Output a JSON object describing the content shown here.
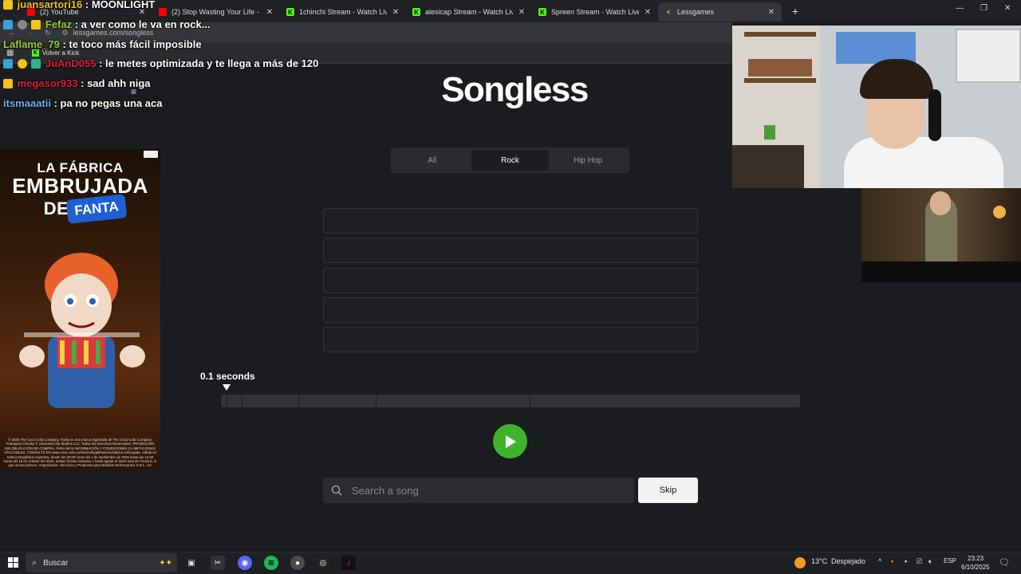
{
  "browser": {
    "tabs": [
      {
        "title": "(2) YouTube",
        "favicon": "youtube-icon",
        "color": "#ff0000"
      },
      {
        "title": "(2) Stop Wasting Your Life - You",
        "favicon": "youtube-icon",
        "color": "#ff0000"
      },
      {
        "title": "1chinchi Stream - Watch Live o",
        "favicon": "kick-icon",
        "color": "#53fc18"
      },
      {
        "title": "alesicap Stream - Watch Live o",
        "favicon": "kick-icon",
        "color": "#53fc18"
      },
      {
        "title": "Spreen Stream - Watch Live on",
        "favicon": "kick-icon",
        "color": "#53fc18"
      },
      {
        "title": "Lessgames",
        "favicon": "lessgames-icon",
        "color": "#e6d25a",
        "active": true
      }
    ],
    "url": "lessgames.com/songless",
    "bookmark": "Volver a Kick"
  },
  "chat": [
    {
      "user": "juansartori16",
      "msg": "MOONLIGHT",
      "color": "#f0c419"
    },
    {
      "user": "Fefaz",
      "msg": "a ver como le va en rock...",
      "color": "#9acd32"
    },
    {
      "user": "Laflame_79",
      "msg": "te toco más fácil imposible",
      "color": "#9acd32"
    },
    {
      "user": "JuAnD055",
      "msg": "le metes optimizada y te llega a más de 120",
      "color": "#d9213a"
    },
    {
      "user": "megasor933",
      "msg": "sad ahh niga",
      "color": "#d9213a"
    },
    {
      "user": "itsmaaatii",
      "msg": "pa no pegas una aca",
      "color": "#6ab0f3"
    }
  ],
  "game": {
    "logo": "Songless",
    "genres": [
      "All",
      "Rock",
      "Hip Hop"
    ],
    "selected_genre": "Rock",
    "seconds_label": "0.1 seconds",
    "search_placeholder": "Search a song",
    "skip_label": "Skip",
    "accent": "#3fb42a"
  },
  "ad": {
    "line1": "LA FÁBRICA",
    "line2": "EMBRUJADA",
    "line3": "DE",
    "brand": "FANTA",
    "fineprint": "© 2025 The Coca-Cola Company. Fanta es una marca registrada de The Coca-Cola Company. Franquicia Chucky © Universal City Studios LLC. Todos los Derechos Reservados. PROMOCIÓN SIN OBLIGACIÓN DE COMPRA. PARA MÁS INFORMACIÓN Y CONDICIONES O LIMITACIONES APLICABLES, CONSULTE EN www.coca-cola.com/ar/es/legal/fanta-la-fabrica-embrujada. Válida en toda la República Argentina, desde las 00:00 horas del 2 de septiembre de 2025 hasta las 12:00 horas del 16 de octubre del 2025, ambas fechas inclusive o hasta agotar el stock total de Premios, lo que ocurra primero. Organizador: Servicios y Productos para Bebidas Refrescantes S.R.L. con domicilio en Verde 4090, CABA. CUIT N° 30-67770735-8."
  },
  "taskbar": {
    "search": "Buscar",
    "weather": "13°C",
    "weather_desc": "Despejado",
    "lang": "ESP",
    "time": "23:23",
    "date": "6/10/2025"
  }
}
